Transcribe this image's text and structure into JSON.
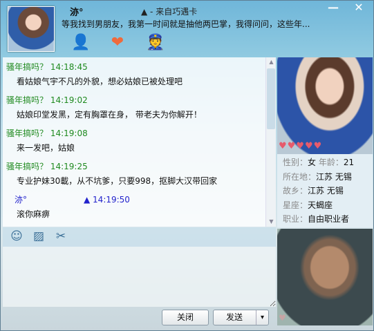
{
  "header": {
    "name": "洂°",
    "from": "▲ - 来自巧遇卡",
    "signature": "等我找到男朋友，我第一时间就是抽他两巴掌，我得问问，这些年...",
    "icons": [
      "add-friend-icon",
      "heart-icon",
      "police-icon"
    ]
  },
  "window": {
    "minimize": "—",
    "close": "✕"
  },
  "messages": [
    {
      "sender": "骚年搞吗？",
      "time": "14:18:45",
      "text": "看姑娘气宇不凡的外貌，想必姑娘已被处理吧",
      "self": false
    },
    {
      "sender": "骚年搞吗？",
      "time": "14:19:02",
      "text": "姑娘印堂发黑，定有胸罩在身， 带老夫为你解开！",
      "self": false
    },
    {
      "sender": "骚年搞吗？",
      "time": "14:19:08",
      "text": "来一发吧，姑娘",
      "self": false
    },
    {
      "sender": "骚年搞吗？",
      "time": "14:19:25",
      "text": "专业护妹30載，从不坑爹，只要998，抠脚大汉带回家",
      "self": false
    },
    {
      "sender": "洂°",
      "time": "▲ 14:19:50",
      "text": "滚你麻痹",
      "self": true
    }
  ],
  "toolbar": {
    "icons": [
      "emoji-icon",
      "image-icon",
      "scissors-icon"
    ]
  },
  "buttons": {
    "close": "关闭",
    "send": "发送",
    "send_menu": "▾"
  },
  "profile": {
    "gender_label": "性别：",
    "gender": "女",
    "age_label": "年龄：",
    "age": "21",
    "location_label": "所在地：",
    "location": "江苏 无锡",
    "hometown_label": "故乡：",
    "hometown": "江苏 无锡",
    "zodiac_label": "星座：",
    "zodiac": "天蝎座",
    "job_label": "职业：",
    "job": "自由职业者",
    "hearts": "♥♥♥♥♥"
  }
}
